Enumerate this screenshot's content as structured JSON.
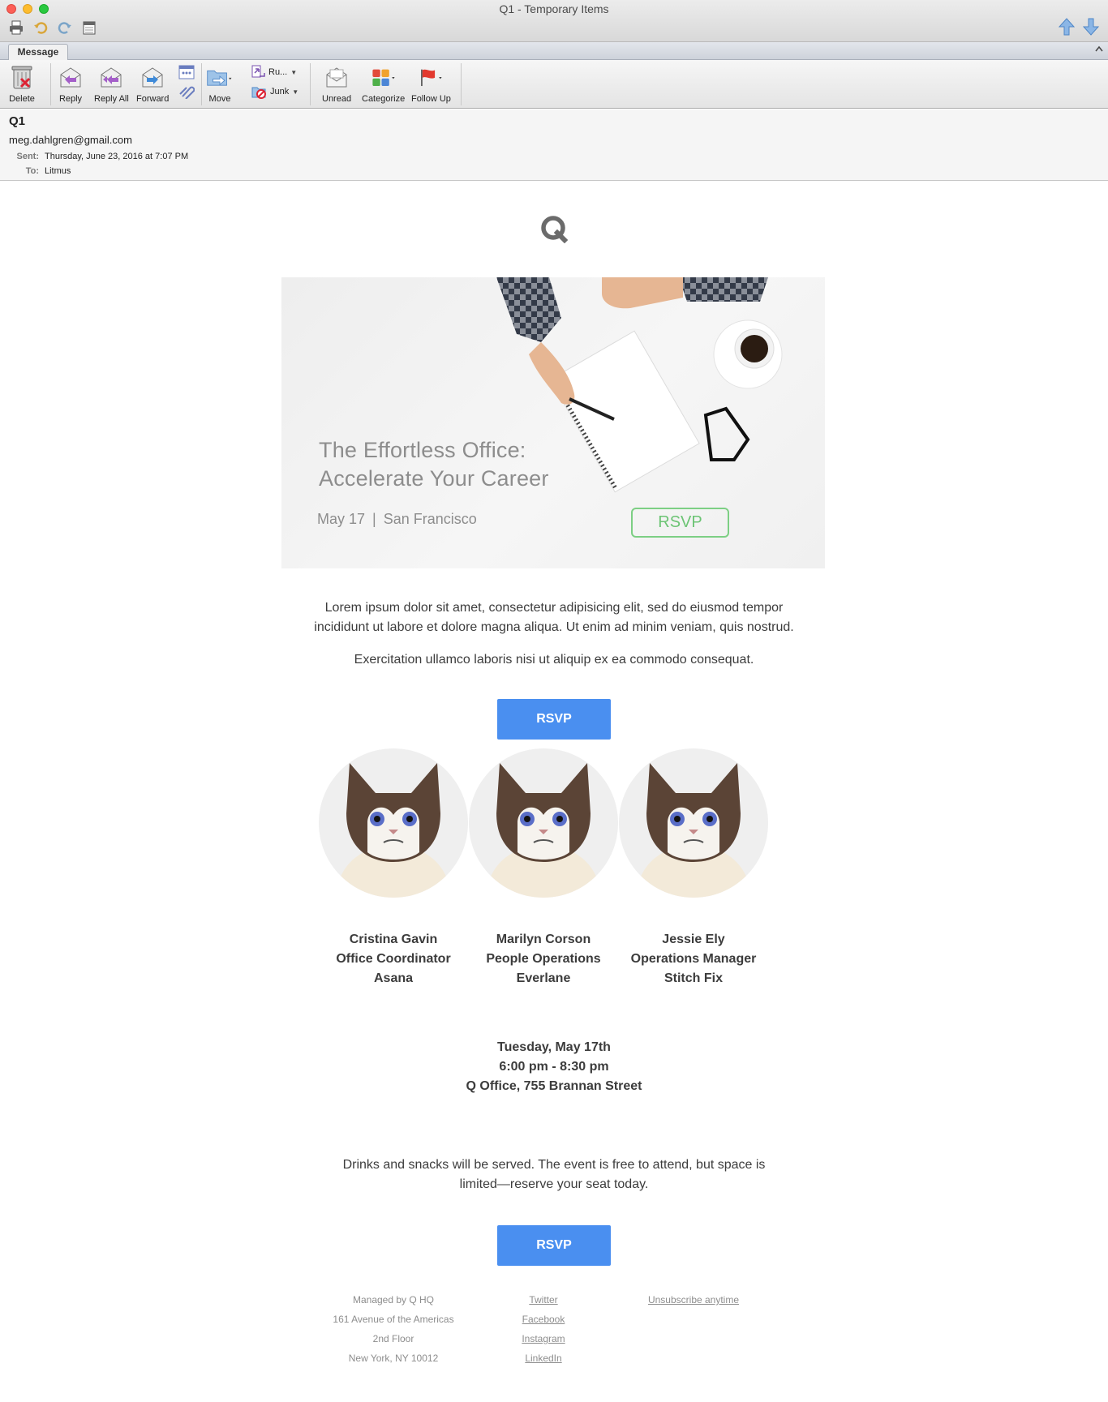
{
  "window": {
    "title": "Q1 - Temporary Items"
  },
  "ribbon": {
    "tab": "Message",
    "buttons": {
      "delete": "Delete",
      "reply": "Reply",
      "reply_all": "Reply All",
      "forward": "Forward",
      "move": "Move",
      "rules": "Ru...",
      "junk": "Junk",
      "unread": "Unread",
      "categorize": "Categorize",
      "follow_up": "Follow Up"
    }
  },
  "message": {
    "subject": "Q1",
    "from": "meg.dahlgren@gmail.com",
    "sent_label": "Sent:",
    "sent_value": "Thursday, June 23, 2016 at 7:07 PM",
    "to_label": "To:",
    "to_value": "Litmus"
  },
  "email": {
    "logo_letter": "Q",
    "hero": {
      "title_line1": "The Effortless Office:",
      "title_line2": "Accelerate Your Career",
      "date": "May 17",
      "separator": "|",
      "city": "San Francisco",
      "rsvp": "RSVP"
    },
    "intro_line1": "Lorem ipsum dolor sit amet, consectetur adipisicing elit, sed do eiusmod tempor",
    "intro_line2": "incididunt ut labore et dolore magna aliqua. Ut enim ad minim veniam, quis nostrud.",
    "intro_line3": "Exercitation ullamco laboris nisi ut aliquip ex ea commodo consequat.",
    "rsvp_button": "RSVP",
    "speakers": [
      {
        "name": "Cristina Gavin",
        "title": "Office Coordinator",
        "company": "Asana"
      },
      {
        "name": "Marilyn Corson",
        "title": "People Operations",
        "company": "Everlane"
      },
      {
        "name": "Jessie Ely",
        "title": "Operations Manager",
        "company": "Stitch Fix"
      }
    ],
    "event": {
      "date": "Tuesday, May 17th",
      "time": "6:00 pm - 8:30 pm",
      "location": "Q Office, 755 Brannan Street"
    },
    "closing_line1": "Drinks and snacks will be served. The event is free to attend, but space is",
    "closing_line2": "limited—reserve your seat today.",
    "rsvp_button_2": "RSVP",
    "footer": {
      "address": [
        "Managed by Q HQ",
        "161 Avenue of the Americas",
        "2nd Floor",
        "New York, NY 10012"
      ],
      "social": [
        "Twitter",
        "Facebook",
        "Instagram",
        "LinkedIn"
      ],
      "unsubscribe": "Unsubscribe anytime"
    }
  },
  "colors": {
    "accent_button": "#4a8ff0",
    "hero_rsvp": "#6cc474",
    "body_text": "#3c3c3c",
    "muted_text": "#8d8d8d"
  }
}
